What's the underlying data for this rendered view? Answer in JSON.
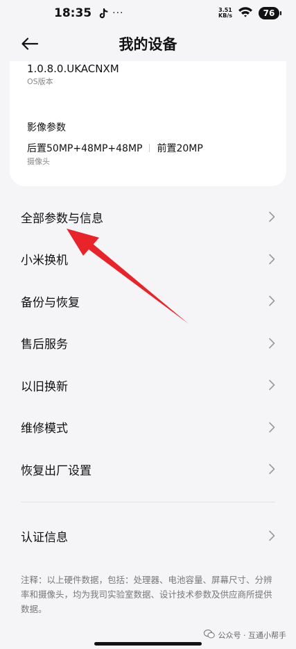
{
  "status_bar": {
    "time": "18:35",
    "dots": "···",
    "net_speed_value": "3.51",
    "net_speed_unit": "KB/s",
    "battery": "76"
  },
  "header": {
    "title": "我的设备"
  },
  "card": {
    "os_version": "1.0.8.0.UKACNXM",
    "os_label": "OS版本",
    "camera_title": "影像参数",
    "camera_rear": "后置50MP+48MP+48MP",
    "camera_front": "前置20MP",
    "camera_label": "摄像头"
  },
  "menu": {
    "items": [
      {
        "label": "全部参数与信息"
      },
      {
        "label": "小米换机"
      },
      {
        "label": "备份与恢复"
      },
      {
        "label": "售后服务"
      },
      {
        "label": "以旧换新"
      },
      {
        "label": "维修模式"
      },
      {
        "label": "恢复出厂设置"
      }
    ],
    "cert_label": "认证信息"
  },
  "footnote": "注释：以上硬件数据，包括：处理器、电池容量、屏幕尺寸、分辨率和摄像头，均为我司实验室数据、设计技术参数及供应商所提供数据。",
  "watermark": "公众号 · 互通小帮手",
  "colors": {
    "annotation_arrow": "#e8242a",
    "background": "#f5f5f7",
    "card": "#ffffff"
  }
}
